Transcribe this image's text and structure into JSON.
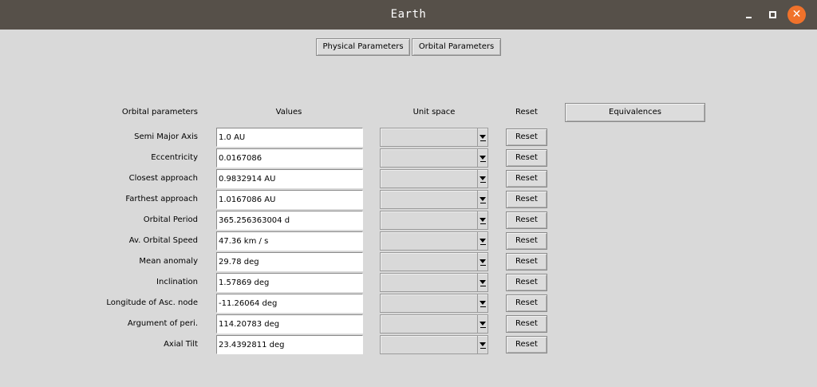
{
  "window": {
    "title": "Earth",
    "controls": {
      "minimize": "minimize-icon",
      "maximize": "maximize-icon",
      "close": "close-icon",
      "close_color": "#f0722b"
    },
    "titlebar_color": "#565049",
    "background_color": "#d9d9d9"
  },
  "tabs": [
    {
      "label": "Physical Parameters"
    },
    {
      "label": "Orbital Parameters"
    }
  ],
  "headers": {
    "params": "Orbital parameters",
    "values": "Values",
    "unit": "Unit space",
    "reset": "Reset"
  },
  "equivalences_label": "Equivalences",
  "reset_label": "Reset",
  "rows": [
    {
      "label": "Semi Major Axis",
      "value": "1.0 AU"
    },
    {
      "label": "Eccentricity",
      "value": "0.0167086"
    },
    {
      "label": "Closest approach",
      "value": "0.9832914 AU"
    },
    {
      "label": "Farthest approach",
      "value": "1.0167086 AU"
    },
    {
      "label": "Orbital Period",
      "value": "365.256363004 d"
    },
    {
      "label": "Av. Orbital Speed",
      "value": "47.36 km / s"
    },
    {
      "label": "Mean anomaly",
      "value": "29.78 deg"
    },
    {
      "label": "Inclination",
      "value": "1.57869 deg"
    },
    {
      "label": "Longitude of Asc. node",
      "value": "-11.26064 deg"
    },
    {
      "label": "Argument of peri.",
      "value": "114.20783 deg"
    },
    {
      "label": "Axial Tilt",
      "value": "23.4392811 deg"
    }
  ]
}
